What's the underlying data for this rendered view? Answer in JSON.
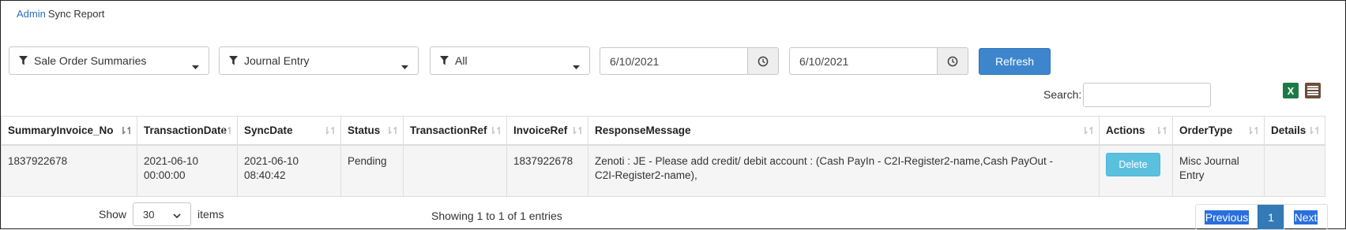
{
  "breadcrumb": {
    "parent": "Admin",
    "current": "Sync Report"
  },
  "filters": {
    "report": "Sale Order Summaries",
    "type": "Journal Entry",
    "status": "All"
  },
  "dates": {
    "from": "6/10/2021",
    "to": "6/10/2021"
  },
  "refresh_label": "Refresh",
  "search_label": "Search:",
  "export_excel_glyph": "X",
  "table": {
    "columns": [
      "SummaryInvoice_No",
      "TransactionDate",
      "SyncDate",
      "Status",
      "TransactionRef",
      "InvoiceRef",
      "ResponseMessage",
      "Actions",
      "OrderType",
      "Details"
    ],
    "rows": [
      {
        "summary_invoice_no": "1837922678",
        "transaction_date": [
          "2021-06-10",
          "00:00:00"
        ],
        "sync_date": [
          "2021-06-10",
          "08:40:42"
        ],
        "status": "Pending",
        "transaction_ref": "",
        "invoice_ref": "1837922678",
        "response_message": "Zenoti : JE - Please add credit/ debit account : (Cash PayIn - C2I-Register2-name,Cash PayOut - C2I-Register2-name),",
        "action_label": "Delete",
        "order_type": "Misc Journal Entry",
        "details": ""
      }
    ]
  },
  "footer": {
    "show_label": "Show",
    "page_size": "30",
    "items_label": "items",
    "info": "Showing 1 to 1 of 1 entries",
    "previous": "Previous",
    "current_page": "1",
    "next": "Next"
  },
  "colors": {
    "primary": "#3d86cd",
    "info": "#5bc0de",
    "excel": "#1d7a45"
  }
}
